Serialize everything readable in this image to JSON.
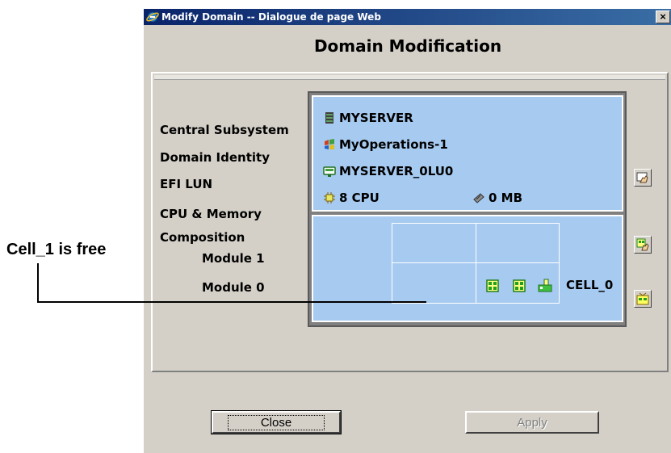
{
  "window": {
    "title": "Modify Domain -- Dialogue de page Web",
    "close_glyph": "×",
    "heading": "Domain Modification"
  },
  "labels": {
    "central_subsystem": "Central Subsystem",
    "domain_identity": "Domain Identity",
    "efi_lun": "EFI LUN",
    "cpu_memory": "CPU & Memory",
    "composition": "Composition",
    "module1": "Module 1",
    "module0": "Module 0"
  },
  "info": {
    "server": "MYSERVER",
    "identity": "MyOperations-1",
    "efi_lun": "MYSERVER_0LU0",
    "cpu": "8 CPU",
    "memory": "0 MB"
  },
  "composition": {
    "cell_label": "CELL_0"
  },
  "buttons": {
    "close": "Close",
    "apply": "Apply"
  },
  "annotation": {
    "text": "Cell_1 is free"
  },
  "colors": {
    "panel_blue": "#a6caf0",
    "dialog_gray": "#d4d0c8",
    "titlebar": "#0a246a"
  },
  "icons": {
    "server": "server-icon",
    "identity": "windows-identity-icon",
    "lun": "disk-icon",
    "cpu": "chip-icon",
    "memory": "memory-icon",
    "modify_identity": "hand-edit-icon",
    "modify_composition": "edit-composition-icon",
    "add_cell": "add-cell-icon"
  }
}
